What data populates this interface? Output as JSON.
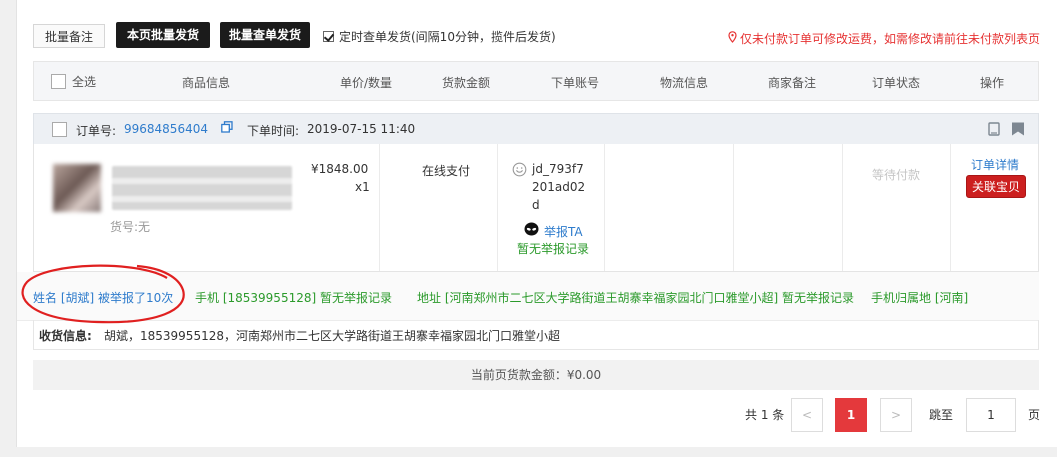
{
  "toolbar": {
    "batch_note": "批量备注",
    "page_batch_ship": "本页批量发货",
    "batch_check_ship": "批量查单发货",
    "timed_check": "定时查单发货(间隔10分钟，揽件后发货)",
    "tip": "仅未付款订单可修改运费，如需修改请前往未付款列表页"
  },
  "table_header": {
    "select_all": "全选",
    "cols": [
      "商品信息",
      "单价/数量",
      "货款金额",
      "下单账号",
      "物流信息",
      "商家备注",
      "订单状态",
      "操作"
    ]
  },
  "order": {
    "no_label": "订单号:",
    "no": "99684856404",
    "time_label": "下单时间:",
    "time": "2019-07-15 11:40",
    "sku_label": "货号:无",
    "price": "¥1848.00",
    "qty": "x1",
    "payment": "在线支付",
    "account": "jd_793f7201ad02d",
    "account_lines": [
      "jd_793f7",
      "201ad02",
      "d"
    ],
    "report_link": "举报TA",
    "no_report": "暂无举报记录",
    "status": "等待付款",
    "detail_link": "订单详情",
    "related_item": "关联宝贝"
  },
  "report": {
    "name_part": "姓名 [胡斌] 被举报了10次",
    "phone_part": "手机 [18539955128] 暂无举报记录",
    "address_part": "地址 [河南郑州市二七区大学路街道王胡寨幸福家园北门口雅堂小超] 暂无举报记录",
    "region_part": "手机归属地 [河南]"
  },
  "shipping": {
    "label": "收货信息:",
    "value": "胡斌，18539955128，河南郑州市二七区大学路街道王胡寨幸福家园北门口雅堂小超"
  },
  "summary": {
    "total": "当前页货款金额：¥0.00"
  },
  "pagination": {
    "total": "共 1 条",
    "prev": "<",
    "current": "1",
    "next": ">",
    "jump_label": "跳至",
    "jump_value": "1",
    "page_unit": "页"
  },
  "colors": {
    "accent_red": "#e4393c",
    "link_blue": "#2f7ccc",
    "green": "#2b9a2b",
    "dark_button": "#1b1b1b"
  }
}
